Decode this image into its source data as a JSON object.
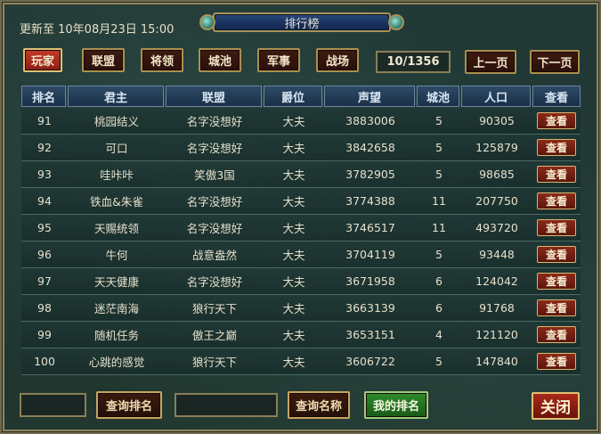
{
  "update_time": "更新至 10年08月23日 15:00",
  "title": "排行榜",
  "tabs": [
    {
      "label": "玩家",
      "active": true
    },
    {
      "label": "联盟",
      "active": false
    },
    {
      "label": "将领",
      "active": false
    },
    {
      "label": "城池",
      "active": false
    },
    {
      "label": "军事",
      "active": false
    },
    {
      "label": "战场",
      "active": false
    }
  ],
  "pagination": {
    "indicator": "10/1356",
    "prev_label": "上一页",
    "next_label": "下一页"
  },
  "table": {
    "columns": [
      "排名",
      "君主",
      "联盟",
      "爵位",
      "声望",
      "城池",
      "人口",
      "查看"
    ],
    "rows": [
      {
        "rank": "91",
        "lord": "桃园结义",
        "alliance": "名字没想好",
        "title": "大夫",
        "prestige": "3883006",
        "cities": "5",
        "population": "90305",
        "view": "查看"
      },
      {
        "rank": "92",
        "lord": "可口",
        "alliance": "名字没想好",
        "title": "大夫",
        "prestige": "3842658",
        "cities": "5",
        "population": "125879",
        "view": "查看"
      },
      {
        "rank": "93",
        "lord": "哇咔咔",
        "alliance": "笑傲3国",
        "title": "大夫",
        "prestige": "3782905",
        "cities": "5",
        "population": "98685",
        "view": "查看"
      },
      {
        "rank": "94",
        "lord": "铁血&朱雀",
        "alliance": "名字没想好",
        "title": "大夫",
        "prestige": "3774388",
        "cities": "11",
        "population": "207750",
        "view": "查看"
      },
      {
        "rank": "95",
        "lord": "天赐统领",
        "alliance": "名字没想好",
        "title": "大夫",
        "prestige": "3746517",
        "cities": "11",
        "population": "493720",
        "view": "查看"
      },
      {
        "rank": "96",
        "lord": "牛何",
        "alliance": "战意盎然",
        "title": "大夫",
        "prestige": "3704119",
        "cities": "5",
        "population": "93448",
        "view": "查看"
      },
      {
        "rank": "97",
        "lord": "天天健康",
        "alliance": "名字没想好",
        "title": "大夫",
        "prestige": "3671958",
        "cities": "6",
        "population": "124042",
        "view": "查看"
      },
      {
        "rank": "98",
        "lord": "迷茫南海",
        "alliance": "狼行天下",
        "title": "大夫",
        "prestige": "3663139",
        "cities": "6",
        "population": "91768",
        "view": "查看"
      },
      {
        "rank": "99",
        "lord": "随机任务",
        "alliance": "傲王之巅",
        "title": "大夫",
        "prestige": "3653151",
        "cities": "4",
        "population": "121120",
        "view": "查看"
      },
      {
        "rank": "100",
        "lord": "心跳的感觉",
        "alliance": "狼行天下",
        "title": "大夫",
        "prestige": "3606722",
        "cities": "5",
        "population": "147840",
        "view": "查看"
      }
    ]
  },
  "search": {
    "rank_input_value": "",
    "rank_button": "查询排名",
    "name_input_value": "",
    "name_button": "查询名称",
    "my_rank_button": "我的排名"
  },
  "close_label": "关闭"
}
